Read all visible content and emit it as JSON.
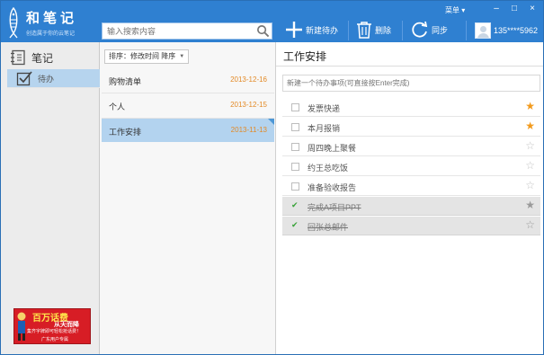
{
  "app": {
    "name": "和笔记",
    "slogan": "创造属于你的云笔记",
    "menu_label": "菜单 ▾",
    "window_controls": [
      "–",
      "□",
      "×"
    ]
  },
  "search": {
    "placeholder": "输入搜索内容"
  },
  "toolbar": {
    "new_label": "新建待办",
    "delete_label": "删除",
    "sync_label": "同步"
  },
  "user": {
    "name": "135****5962"
  },
  "sidebar": {
    "items": [
      {
        "label": "笔记",
        "icon": "notebook-icon"
      },
      {
        "label": "待办",
        "icon": "checkbox-icon",
        "active": true
      }
    ],
    "ad": {
      "line1": "百万话费",
      "line2": "从天而降",
      "line3": "集齐字牌即可轻松抢话费！",
      "line4": "广东用户专属"
    }
  },
  "list": {
    "sort_label": "排序：修改时间  降序",
    "items": [
      {
        "title": "购物清单",
        "date": "2013-12-16"
      },
      {
        "title": "个人",
        "date": "2013-12-15"
      },
      {
        "title": "工作安排",
        "date": "2013-11-13",
        "selected": true
      }
    ]
  },
  "content": {
    "title": "工作安排",
    "new_placeholder": "新建一个待办事项(可直接按Enter完成)",
    "todos": [
      {
        "text": "发票快递",
        "done": false,
        "starred": true
      },
      {
        "text": "本月报销",
        "done": false,
        "starred": true
      },
      {
        "text": "周四晚上聚餐",
        "done": false,
        "starred": false
      },
      {
        "text": "约王总吃饭",
        "done": false,
        "starred": false
      },
      {
        "text": "准备验收报告",
        "done": false,
        "starred": false
      },
      {
        "text": "完成A项目PPT",
        "done": true,
        "starred": false
      },
      {
        "text": "回张总邮件",
        "done": true,
        "starred": false
      }
    ]
  },
  "colors": {
    "titlebar": "#2f80d1",
    "nav_active": "#b6d4ee",
    "date_orange": "#e38a27",
    "star_orange": "#f29a1c"
  }
}
